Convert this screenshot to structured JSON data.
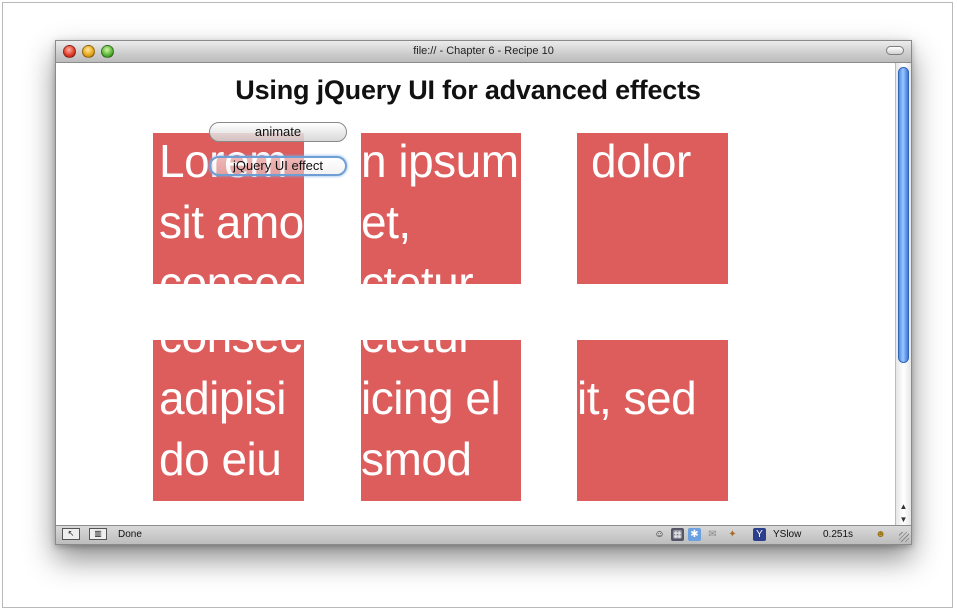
{
  "window": {
    "title": "file:// - Chapter 6 - Recipe 10"
  },
  "page": {
    "heading": "Using jQuery UI for advanced effects",
    "buttons": {
      "animate": "animate",
      "effect": "jQuery UI effect"
    },
    "box_fragments": [
      {
        "lines": [
          "Lorem",
          "sit amo",
          "consec"
        ]
      },
      {
        "lines": [
          "n ipsum",
          "et,",
          "ctetur"
        ]
      },
      {
        "lines": [
          "dolor",
          "",
          ""
        ]
      },
      {
        "lines": [
          "consec",
          "adipisi",
          "do eiu"
        ]
      },
      {
        "lines": [
          "ctetur",
          "icing el",
          "smod"
        ]
      },
      {
        "lines": [
          "",
          "it, sed",
          ""
        ]
      }
    ]
  },
  "status": {
    "text": "Done",
    "yslow_label": "YSlow",
    "timing": "0.251s"
  },
  "colors": {
    "box": "#dd5c5c",
    "focus_ring": "#6f9ed4",
    "scroll_thumb": "#4f8ee6"
  }
}
